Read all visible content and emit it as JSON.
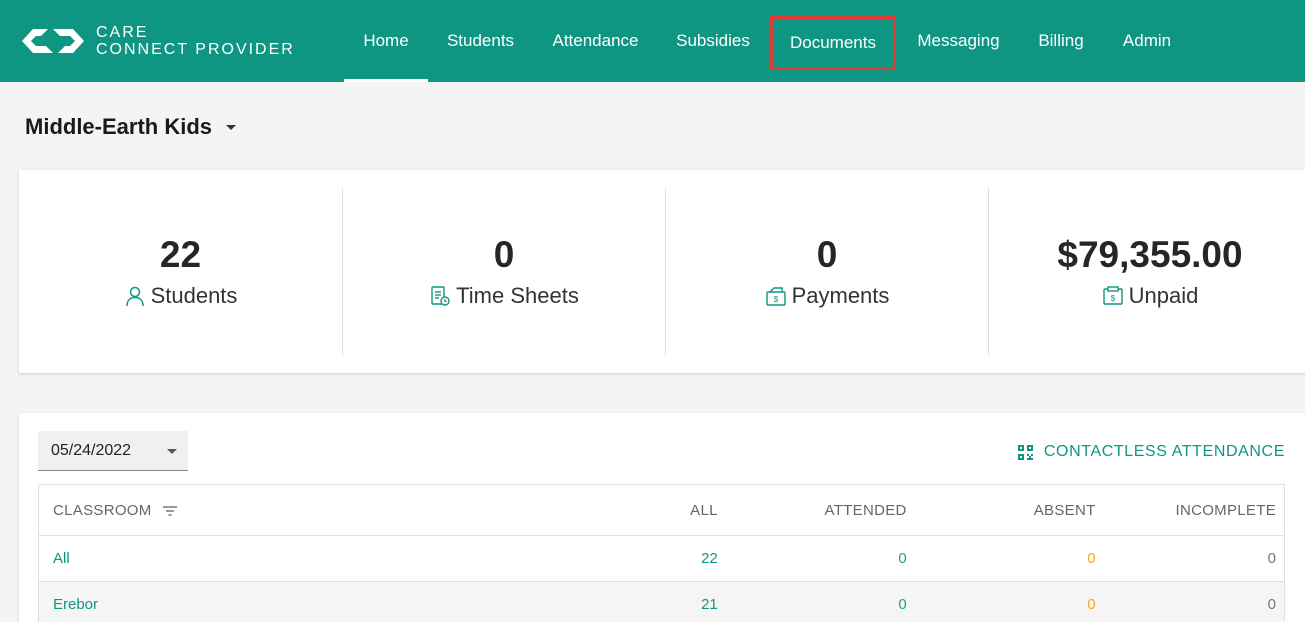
{
  "app": {
    "logo_line1": "CARE",
    "logo_line2": "CONNECT PROVIDER"
  },
  "nav": {
    "items": [
      {
        "label": "Home",
        "state": "active"
      },
      {
        "label": "Students",
        "state": ""
      },
      {
        "label": "Attendance",
        "state": ""
      },
      {
        "label": "Subsidies",
        "state": ""
      },
      {
        "label": "Documents",
        "state": "highlighted"
      },
      {
        "label": "Messaging",
        "state": ""
      },
      {
        "label": "Billing",
        "state": ""
      },
      {
        "label": "Admin",
        "state": ""
      }
    ]
  },
  "org": {
    "name": "Middle-Earth Kids"
  },
  "stats": [
    {
      "value": "22",
      "label": "Students",
      "icon": "person-icon"
    },
    {
      "value": "0",
      "label": "Time Sheets",
      "icon": "timesheet-icon"
    },
    {
      "value": "0",
      "label": "Payments",
      "icon": "payment-icon"
    },
    {
      "value": "$79,355.00",
      "label": "Unpaid",
      "icon": "invoice-icon"
    }
  ],
  "attendance": {
    "date": "05/24/2022",
    "contactless_label": "CONTACTLESS ATTENDANCE",
    "columns": [
      "CLASSROOM",
      "ALL",
      "ATTENDED",
      "ABSENT",
      "INCOMPLETE"
    ],
    "rows": [
      {
        "classroom": "All",
        "all": "22",
        "attended": "0",
        "absent": "0",
        "incomplete": "0"
      },
      {
        "classroom": "Erebor",
        "all": "21",
        "attended": "0",
        "absent": "0",
        "incomplete": "0"
      }
    ]
  },
  "colors": {
    "brand": "#0f9682",
    "highlight": "#e53935",
    "attended": "#19a974",
    "absent": "#f5a623"
  }
}
